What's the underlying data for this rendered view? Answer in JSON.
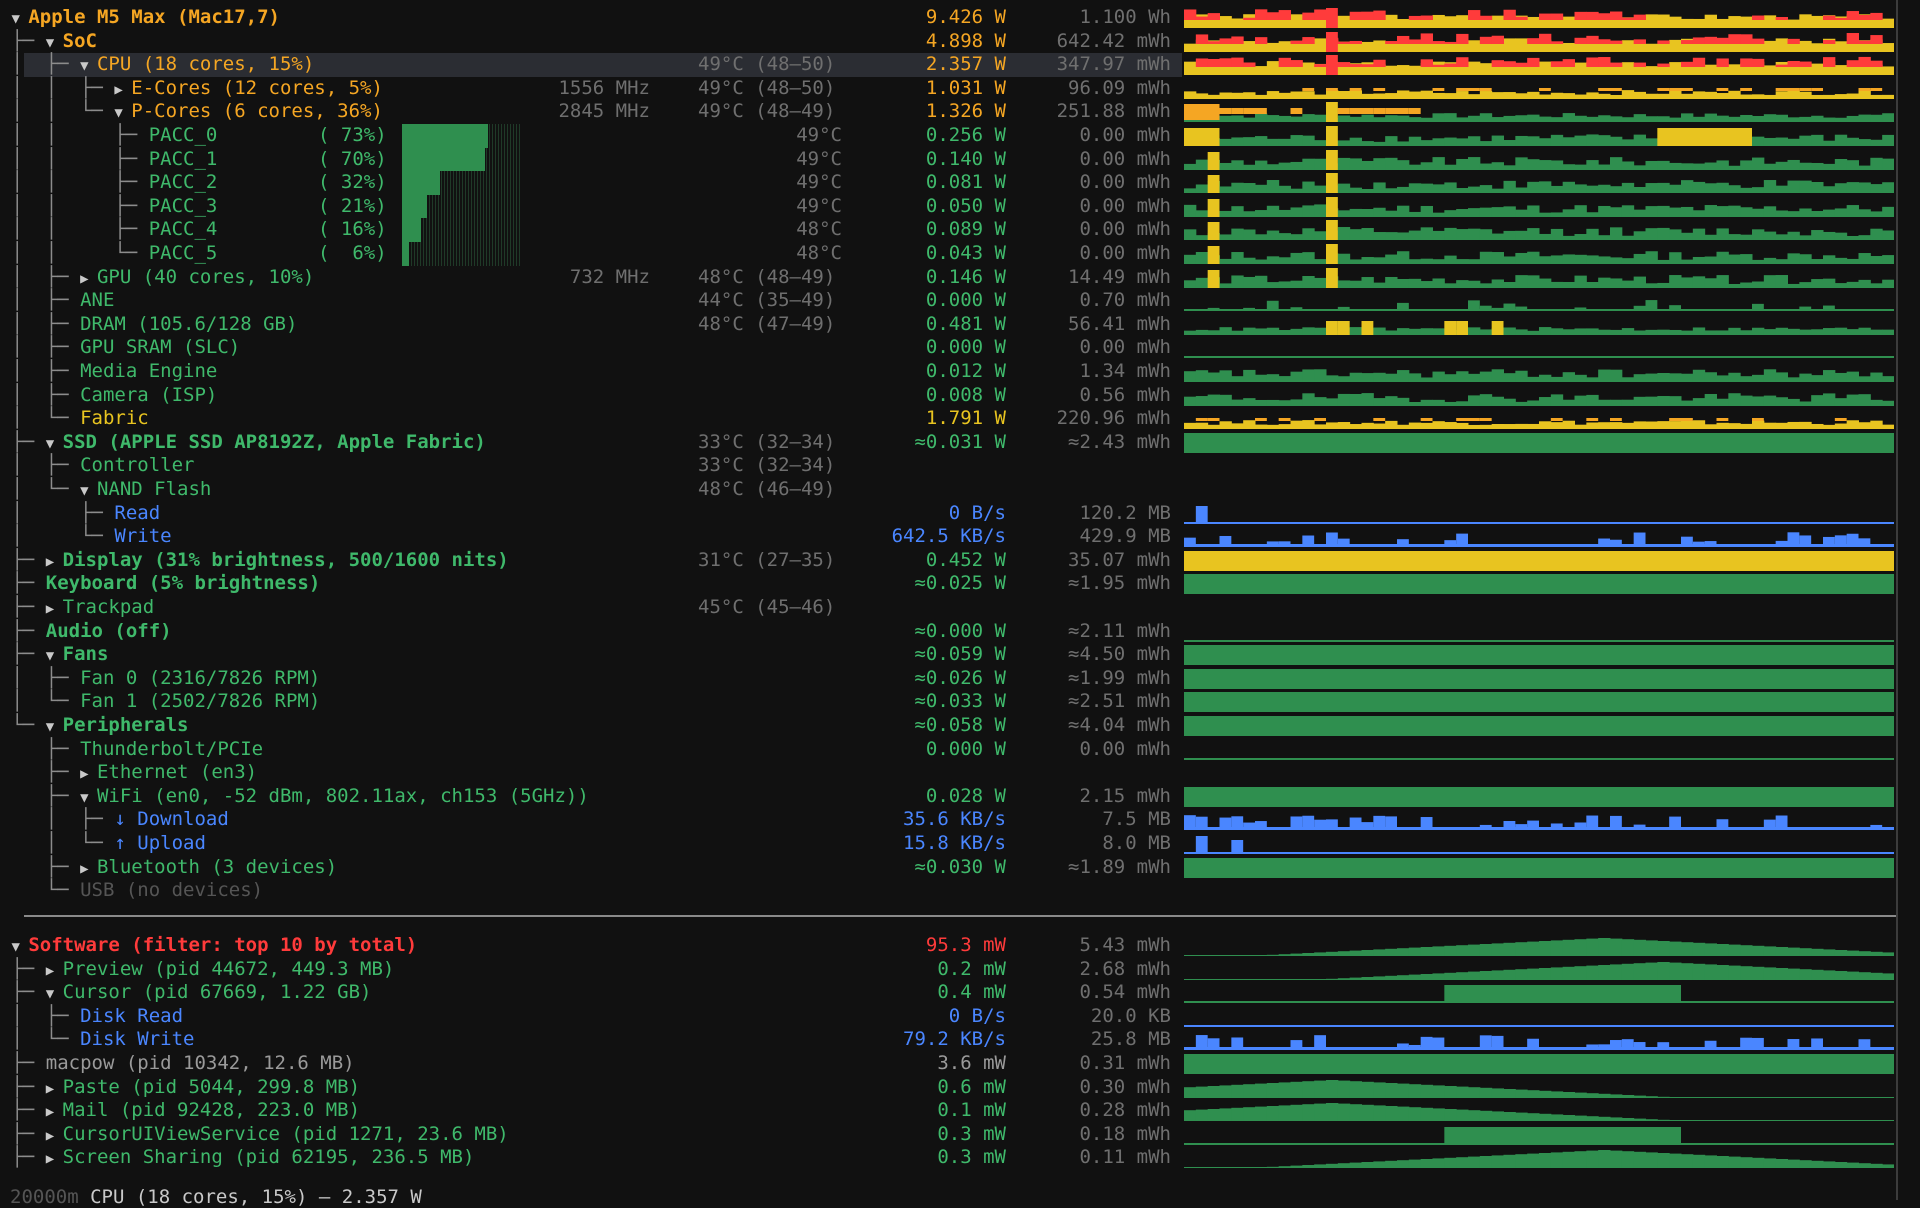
{
  "colors": {
    "orange": "#f5a623",
    "yellow": "#e8c420",
    "green": "#2f8f4f",
    "blue": "#4a86ff",
    "red": "#ff3b3b",
    "selected_row_bg": "#2b2d33"
  },
  "icons": {
    "expanded": "▼",
    "collapsed": "▶"
  },
  "tree": [
    {
      "name": "Apple M5 Max (Mac17,7)",
      "color": "orange",
      "bold": true,
      "toggle": "expanded",
      "prefix": " ",
      "power": "9.426 W",
      "power_color": "orange",
      "energy": "1.100 Wh",
      "graph": "multi-red"
    },
    {
      "name": "SoC",
      "color": "orange",
      "bold": true,
      "toggle": "expanded",
      "prefix": " ├─ ",
      "power": "4.898 W",
      "power_color": "orange",
      "energy": "642.42 mWh",
      "graph": "multi-red"
    },
    {
      "name": "CPU (18 cores, 15%)",
      "color": "orange",
      "toggle": "expanded",
      "prefix": " │  ├─ ",
      "temp": "49°C (48–50)",
      "power": "2.357 W",
      "power_color": "orange",
      "energy": "347.97 mWh",
      "graph": "multi-red",
      "selected": true
    },
    {
      "name": "E-Cores (12 cores, 5%)",
      "color": "orange",
      "toggle": "collapsed",
      "prefix": " │  │  ├─ ",
      "mhz": "1556 MHz",
      "temp": "49°C (48–50)",
      "power": "1.031 W",
      "power_color": "orange",
      "energy": "96.09 mWh",
      "graph": "multi-yellow"
    },
    {
      "name": "P-Cores (6 cores, 36%)",
      "color": "orange",
      "toggle": "expanded",
      "prefix": " │  │  └─ ",
      "mhz": "2845 MHz",
      "temp": "49°C (48–49)",
      "power": "1.326 W",
      "power_color": "orange",
      "energy": "251.88 mWh",
      "graph": "multi-orange"
    },
    {
      "name": "PACC_0",
      "pct": "( 73%)",
      "color": "green",
      "prefix": " │  │     ├─ ",
      "temp_r": "49°C",
      "power": "0.256 W",
      "power_color": "green",
      "energy": "0.00 mWh",
      "graph": "green-peak",
      "core_load": 0.73
    },
    {
      "name": "PACC_1",
      "pct": "( 70%)",
      "color": "green",
      "prefix": " │  │     ├─ ",
      "temp_r": "49°C",
      "power": "0.140 W",
      "power_color": "green",
      "energy": "0.00 mWh",
      "graph": "green",
      "core_load": 0.7
    },
    {
      "name": "PACC_2",
      "pct": "( 32%)",
      "color": "green",
      "prefix": " │  │     ├─ ",
      "temp_r": "49°C",
      "power": "0.081 W",
      "power_color": "green",
      "energy": "0.00 mWh",
      "graph": "green",
      "core_load": 0.32
    },
    {
      "name": "PACC_3",
      "pct": "( 21%)",
      "color": "green",
      "prefix": " │  │     ├─ ",
      "temp_r": "49°C",
      "power": "0.050 W",
      "power_color": "green",
      "energy": "0.00 mWh",
      "graph": "green",
      "core_load": 0.21
    },
    {
      "name": "PACC_4",
      "pct": "( 16%)",
      "color": "green",
      "prefix": " │  │     ├─ ",
      "temp_r": "48°C",
      "power": "0.089 W",
      "power_color": "green",
      "energy": "0.00 mWh",
      "graph": "green",
      "core_load": 0.16
    },
    {
      "name": "PACC_5",
      "pct": "(  6%)",
      "color": "green",
      "prefix": " │  │     └─ ",
      "temp_r": "48°C",
      "power": "0.043 W",
      "power_color": "green",
      "energy": "0.00 mWh",
      "graph": "green",
      "core_load": 0.06
    },
    {
      "name": "GPU (40 cores, 10%)",
      "color": "green",
      "toggle": "collapsed",
      "prefix": " │  ├─ ",
      "mhz": "732 MHz",
      "temp": "48°C (48–49)",
      "power": "0.146 W",
      "power_color": "green",
      "energy": "14.49 mWh",
      "graph": "green"
    },
    {
      "name": "ANE",
      "color": "green",
      "prefix": " │  ├─ ",
      "temp": "44°C (35–49)",
      "power": "0.000 W",
      "power_color": "green",
      "energy": "0.70 mWh",
      "graph": "green-low"
    },
    {
      "name": "DRAM (105.6/128 GB)",
      "color": "green",
      "prefix": " │  ├─ ",
      "temp": "48°C (47–49)",
      "power": "0.481 W",
      "power_color": "green",
      "energy": "56.41 mWh",
      "graph": "green-yellow"
    },
    {
      "name": "GPU SRAM (SLC)",
      "color": "green",
      "prefix": " │  ├─ ",
      "power": "0.000 W",
      "power_color": "green",
      "energy": "0.00 mWh",
      "graph": "line-green"
    },
    {
      "name": "Media Engine",
      "color": "green",
      "prefix": " │  ├─ ",
      "power": "0.012 W",
      "power_color": "green",
      "energy": "1.34 mWh",
      "graph": "green"
    },
    {
      "name": "Camera (ISP)",
      "color": "green",
      "prefix": " │  ├─ ",
      "power": "0.008 W",
      "power_color": "green",
      "energy": "0.56 mWh",
      "graph": "green"
    },
    {
      "name": "Fabric",
      "color": "yellow",
      "prefix": " │  └─ ",
      "power": "1.791 W",
      "power_color": "yellow",
      "energy": "220.96 mWh",
      "graph": "multi-yellow"
    },
    {
      "name": "SSD (APPLE SSD AP8192Z, Apple Fabric)",
      "color": "green",
      "bold": true,
      "toggle": "expanded",
      "prefix": " ├─ ",
      "temp": "33°C (32–34)",
      "power": "≈0.031 W",
      "power_color": "green",
      "energy": "≈2.43 mWh",
      "graph": "full-green"
    },
    {
      "name": "Controller",
      "color": "green",
      "prefix": " │  ├─ ",
      "temp": "33°C (32–34)"
    },
    {
      "name": "NAND Flash",
      "color": "green",
      "toggle": "expanded",
      "prefix": " │  └─ ",
      "temp": "48°C (46–49)"
    },
    {
      "name": "Read",
      "color": "blue",
      "prefix": " │     ├─ ",
      "power": "0 B/s",
      "power_color": "blue",
      "energy": "120.2 MB",
      "graph": "blue-spike"
    },
    {
      "name": "Write",
      "color": "blue",
      "prefix": " │     └─ ",
      "power": "642.5 KB/s",
      "power_color": "blue",
      "energy": "429.9 MB",
      "graph": "blue"
    },
    {
      "name": "Display (31% brightness, 500/1600 nits)",
      "color": "green",
      "bold": true,
      "toggle": "collapsed",
      "prefix": " ├─ ",
      "temp": "31°C (27–35)",
      "power": "0.452 W",
      "power_color": "green",
      "energy": "35.07 mWh",
      "graph": "full-yellow"
    },
    {
      "name": "Keyboard (5% brightness)",
      "color": "green",
      "bold": true,
      "prefix": " ├─ ",
      "power": "≈0.025 W",
      "power_color": "green",
      "energy": "≈1.95 mWh",
      "graph": "full-green"
    },
    {
      "name": "Trackpad",
      "color": "green",
      "toggle": "collapsed",
      "prefix": " ├─ ",
      "temp": "45°C (45–46)"
    },
    {
      "name": "Audio (off)",
      "color": "green",
      "bold": true,
      "prefix": " ├─ ",
      "power": "≈0.000 W",
      "power_color": "green",
      "energy": "≈2.11 mWh",
      "graph": "line-green"
    },
    {
      "name": "Fans",
      "color": "green",
      "bold": true,
      "toggle": "expanded",
      "prefix": " ├─ ",
      "power": "≈0.059 W",
      "power_color": "green",
      "energy": "≈4.50 mWh",
      "graph": "full-green"
    },
    {
      "name": "Fan 0 (2316/7826 RPM)",
      "color": "green",
      "prefix": " │  ├─ ",
      "power": "≈0.026 W",
      "power_color": "green",
      "energy": "≈1.99 mWh",
      "graph": "full-green"
    },
    {
      "name": "Fan 1 (2502/7826 RPM)",
      "color": "green",
      "prefix": " │  └─ ",
      "power": "≈0.033 W",
      "power_color": "green",
      "energy": "≈2.51 mWh",
      "graph": "full-green"
    },
    {
      "name": "Peripherals",
      "color": "green",
      "bold": true,
      "toggle": "expanded",
      "prefix": " └─ ",
      "power": "≈0.058 W",
      "power_color": "green",
      "energy": "≈4.04 mWh",
      "graph": "full-green"
    },
    {
      "name": "Thunderbolt/PCIe",
      "color": "green",
      "prefix": "    ├─ ",
      "power": "0.000 W",
      "power_color": "green",
      "energy": "0.00 mWh",
      "graph": "line-green"
    },
    {
      "name": "Ethernet (en3)",
      "color": "green",
      "toggle": "collapsed",
      "prefix": "    ├─ "
    },
    {
      "name": "WiFi (en0, -52 dBm, 802.11ax, ch153 (5GHz))",
      "color": "green",
      "toggle": "expanded",
      "prefix": "    ├─ ",
      "power": "0.028 W",
      "power_color": "green",
      "energy": "2.15 mWh",
      "graph": "full-green"
    },
    {
      "name": "↓ Download",
      "color": "blue",
      "prefix": "    │  ├─ ",
      "power": "35.6 KB/s",
      "power_color": "blue",
      "energy": "7.5 MB",
      "graph": "blue"
    },
    {
      "name": "↑ Upload",
      "color": "blue",
      "prefix": "    │  └─ ",
      "power": "15.8 KB/s",
      "power_color": "blue",
      "energy": "8.0 MB",
      "graph": "blue-spike"
    },
    {
      "name": "Bluetooth (3 devices)",
      "color": "green",
      "toggle": "collapsed",
      "prefix": "    ├─ ",
      "power": "≈0.030 W",
      "power_color": "green",
      "energy": "≈1.89 mWh",
      "graph": "full-green"
    },
    {
      "name": "USB (no devices)",
      "color": "dim",
      "prefix": "    └─ "
    }
  ],
  "software": [
    {
      "name": "Software (filter: top 10 by total)",
      "color": "red",
      "bold": true,
      "toggle": "expanded",
      "prefix": " ",
      "power": "95.3 mW",
      "power_color": "red",
      "energy": "5.43 mWh",
      "graph": "hill"
    },
    {
      "name": "Preview (pid 44672, 449.3 MB)",
      "color": "green",
      "toggle": "collapsed",
      "prefix": " ├─ ",
      "power": "0.2 mW",
      "power_color": "green",
      "energy": "2.68 mWh",
      "graph": "hill-right"
    },
    {
      "name": "Cursor (pid 67669, 1.22 GB)",
      "color": "green",
      "toggle": "expanded",
      "prefix": " ├─ ",
      "power": "0.4 mW",
      "power_color": "green",
      "energy": "0.54 mWh",
      "graph": "block-mid"
    },
    {
      "name": "Disk Read",
      "color": "blue",
      "prefix": " │  ├─ ",
      "power": "0 B/s",
      "power_color": "blue",
      "energy": "20.0 KB",
      "graph": "line-blue"
    },
    {
      "name": "Disk Write",
      "color": "blue",
      "prefix": " │  └─ ",
      "power": "79.2 KB/s",
      "power_color": "blue",
      "energy": "25.8 MB",
      "graph": "blue"
    },
    {
      "name": "macpow (pid 10342, 12.6 MB)",
      "color": "grey",
      "prefix": " ├─ ",
      "power": "3.6 mW",
      "power_color": "grey",
      "energy": "0.31 mWh",
      "graph": "full-green"
    },
    {
      "name": "Paste (pid 5044, 299.8 MB)",
      "color": "green",
      "toggle": "collapsed",
      "prefix": " ├─ ",
      "power": "0.6 mW",
      "power_color": "green",
      "energy": "0.30 mWh",
      "graph": "hill-left"
    },
    {
      "name": "Mail (pid 92428, 223.0 MB)",
      "color": "green",
      "toggle": "collapsed",
      "prefix": " ├─ ",
      "power": "0.1 mW",
      "power_color": "green",
      "energy": "0.28 mWh",
      "graph": "hill-left"
    },
    {
      "name": "CursorUIViewService (pid 1271, 23.6 MB)",
      "color": "green",
      "toggle": "collapsed",
      "prefix": " ├─ ",
      "power": "0.3 mW",
      "power_color": "green",
      "energy": "0.18 mWh",
      "graph": "block-mid"
    },
    {
      "name": "Screen Sharing (pid 62195, 236.5 MB)",
      "color": "green",
      "toggle": "collapsed",
      "prefix": " ├─ ",
      "power": "0.3 mW",
      "power_color": "green",
      "energy": "0.11 mWh",
      "graph": "hill"
    }
  ],
  "status": {
    "left": "20000m",
    "text": "CPU (18 cores, 15%) — 2.357 W"
  }
}
